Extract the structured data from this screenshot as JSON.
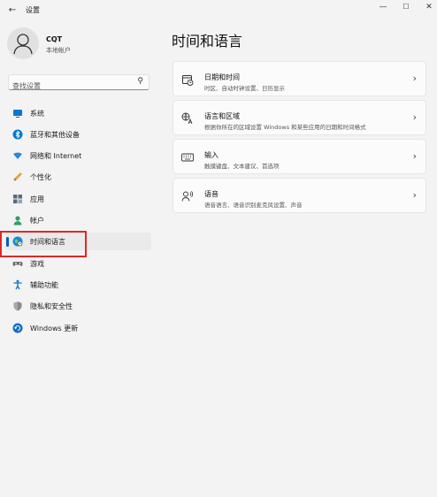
{
  "window": {
    "back_glyph": "←",
    "title": "设置",
    "minimize_glyph": "—",
    "maximize_glyph": "☐",
    "close_glyph": "✕"
  },
  "user": {
    "name": "CQT",
    "account_type": "本地帐户"
  },
  "search": {
    "placeholder": "查找设置",
    "icon": "search-icon"
  },
  "sidebar": {
    "items": [
      {
        "label": "系统",
        "icon": "monitor-icon",
        "active": false
      },
      {
        "label": "蓝牙和其他设备",
        "icon": "bluetooth-icon",
        "active": false
      },
      {
        "label": "网络和 Internet",
        "icon": "wifi-icon",
        "active": false
      },
      {
        "label": "个性化",
        "icon": "pencil-icon",
        "active": false
      },
      {
        "label": "应用",
        "icon": "apps-icon",
        "active": false
      },
      {
        "label": "帐户",
        "icon": "person-icon",
        "active": false
      },
      {
        "label": "时间和语言",
        "icon": "globe-clock-icon",
        "active": true
      },
      {
        "label": "游戏",
        "icon": "gamepad-icon",
        "active": false
      },
      {
        "label": "辅助功能",
        "icon": "accessibility-icon",
        "active": false
      },
      {
        "label": "隐私和安全性",
        "icon": "shield-icon",
        "active": false
      },
      {
        "label": "Windows 更新",
        "icon": "update-icon",
        "active": false
      }
    ]
  },
  "main": {
    "title": "时间和语言",
    "cards": [
      {
        "title": "日期和时间",
        "subtitle": "时区、自动时钟设置、日历显示",
        "icon": "calendar-clock-icon"
      },
      {
        "title": "语言和区域",
        "subtitle": "根据你所在的区域设置 Windows 和某些应用的日期和时间格式",
        "icon": "language-icon"
      },
      {
        "title": "输入",
        "subtitle": "触摸键盘、文本建议、首选项",
        "icon": "keyboard-icon"
      },
      {
        "title": "语音",
        "subtitle": "语音语言、语音识别麦克风设置、声音",
        "icon": "speech-icon"
      }
    ],
    "chevron_glyph": "›"
  },
  "colors": {
    "accent": "#005fb8",
    "annotation_red": "#e02828",
    "background": "#f3f3f3",
    "card": "#fbfbfb"
  }
}
